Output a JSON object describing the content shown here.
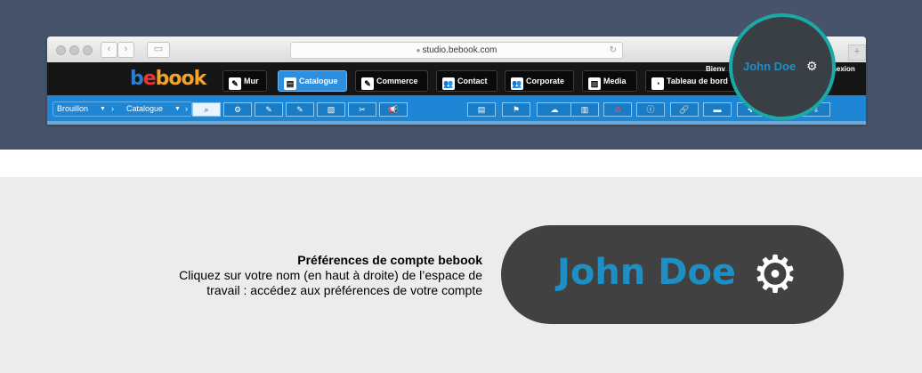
{
  "browser": {
    "url": "studio.bebook.com",
    "nav_back": "‹",
    "nav_forward": "›",
    "sidebar_icon": "▭",
    "reload_icon": "↻",
    "new_tab": "+"
  },
  "app": {
    "logo": {
      "b": "b",
      "e": "e",
      "rest": "book"
    },
    "menu": [
      {
        "label": "Mur",
        "icon": "✎"
      },
      {
        "label": "Catalogue",
        "icon": "▤"
      },
      {
        "label": "Commerce",
        "icon": "✎"
      },
      {
        "label": "Contact",
        "icon": "👥"
      },
      {
        "label": "Corporate",
        "icon": "👥"
      },
      {
        "label": "Media",
        "icon": "▨"
      },
      {
        "label": "Tableau de bord",
        "icon": "◔"
      }
    ],
    "welcome": "Bienv",
    "logout": "nexion"
  },
  "toolbar": {
    "crumbs": [
      "Brouillon",
      "Catalogue"
    ],
    "crumb_caret": "▼",
    "crumb_sep": "›",
    "left_icons": [
      "⌕",
      "⚙",
      "✎",
      "✎",
      "▨",
      "✂",
      "📢"
    ],
    "right_icons": [
      "▤",
      "⚑",
      "☁",
      "▥",
      "⊘",
      "ⓘ",
      "🔗",
      "▬",
      "✚",
      "⇩"
    ]
  },
  "callout": {
    "name": "John Doe",
    "gear": "⚙"
  },
  "explanation": {
    "title": "Préférences de compte bebook",
    "line1": "Cliquez sur votre nom (en haut à droite) de l’espace de",
    "line2": "travail : accédez aux préférences de votre compte"
  },
  "pill": {
    "name": "John Doe",
    "gear": "⚙"
  }
}
